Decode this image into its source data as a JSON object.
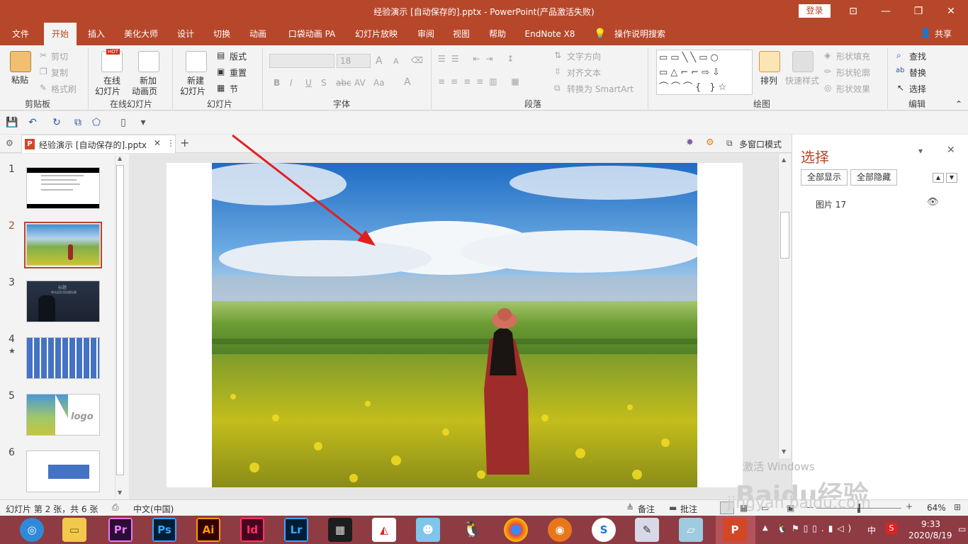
{
  "window": {
    "title": "经验演示 [自动保存的].pptx  -  PowerPoint(产品激活失败)",
    "login_label": "登录",
    "controls": {
      "ribbon_display": "⊡",
      "minimize": "—",
      "maximize": "❐",
      "close": "✕"
    }
  },
  "ribbon_tabs": [
    "文件",
    "开始",
    "插入",
    "美化大师",
    "设计",
    "切换",
    "动画",
    "口袋动画 PA",
    "幻灯片放映",
    "审阅",
    "视图",
    "帮助",
    "EndNote X8"
  ],
  "active_tab": "开始",
  "tell_me": "操作说明搜索",
  "share_label": "共享",
  "ribbon": {
    "clipboard": {
      "paste": "粘贴",
      "cut": "剪切",
      "copy": "复制",
      "format_painter": "格式刷",
      "label": "剪贴板"
    },
    "online_slides": {
      "online": "在线",
      "online2": "幻灯片",
      "new": "新加",
      "new2": "动画页",
      "label": "在线幻灯片",
      "hot": "HOT"
    },
    "slides": {
      "new": "新建",
      "new2": "幻灯片",
      "layout": "版式",
      "reset": "重置",
      "section": "节",
      "label": "幻灯片"
    },
    "font": {
      "font_size": "18",
      "label": "字体",
      "bold": "B",
      "italic": "I",
      "underline": "U",
      "strike": "S",
      "spacing": "AV",
      "case": "Aa",
      "color": "A",
      "grow": "A",
      "shrink": "A"
    },
    "paragraph": {
      "text_direction": "文字方向",
      "align_text": "对齐文本",
      "smartart": "转换为 SmartArt",
      "label": "段落"
    },
    "drawing": {
      "arrange": "排列",
      "quick_styles": "快速样式",
      "fill": "形状填充",
      "outline": "形状轮廓",
      "effects": "形状效果",
      "label": "绘图"
    },
    "editing": {
      "find": "查找",
      "replace": "替换",
      "select": "选择",
      "label": "编辑"
    }
  },
  "doc_tab": {
    "name": "经验演示 [自动保存的].pptx",
    "multi_window": "多窗口模式"
  },
  "slides": [
    {
      "num": "1",
      "star": ""
    },
    {
      "num": "2",
      "star": ""
    },
    {
      "num": "3",
      "star": "",
      "heading": "标题",
      "sub": "单击此处添加副标题"
    },
    {
      "num": "4",
      "star": "★"
    },
    {
      "num": "5",
      "star": "",
      "logo": "logo"
    },
    {
      "num": "6",
      "star": ""
    }
  ],
  "current_slide": 2,
  "selection_pane": {
    "title": "选择",
    "show_all": "全部显示",
    "hide_all": "全部隐藏",
    "items": [
      {
        "name": "图片 17"
      }
    ]
  },
  "status": {
    "slide_info": "幻灯片 第 2 张，共 6 张",
    "language": "中文(中国)",
    "notes": "备注",
    "comments": "批注",
    "zoom": "64%"
  },
  "watermark": {
    "activate": "激活 Windows",
    "site": "jingyan.baidu.com",
    "brand": "Baidu经验"
  },
  "taskbar": {
    "apps": [
      {
        "label": "Pr",
        "color": "#2a0d33",
        "fg": "#ea77ff"
      },
      {
        "label": "Ps",
        "color": "#001d34",
        "fg": "#31a8ff"
      },
      {
        "label": "Ai",
        "color": "#330000",
        "fg": "#ff9a00"
      },
      {
        "label": "Id",
        "color": "#49021f",
        "fg": "#ff3366"
      },
      {
        "label": "Lr",
        "color": "#001d34",
        "fg": "#31a8ff"
      }
    ],
    "ime": "中",
    "time": "9:33",
    "date": "2020/8/19"
  },
  "colors": {
    "accent": "#b7472a",
    "taskbar": "#8f3b44"
  }
}
